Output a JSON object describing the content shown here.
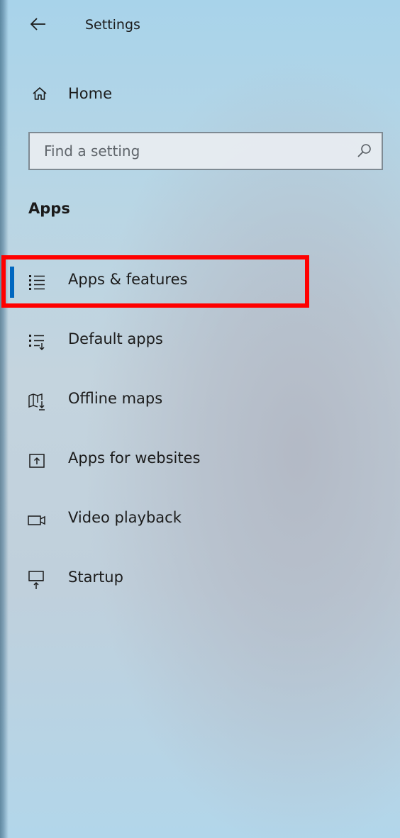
{
  "header": {
    "title": "Settings",
    "back_icon": "back-arrow-icon"
  },
  "home": {
    "label": "Home",
    "icon": "home-icon"
  },
  "search": {
    "placeholder": "Find a setting",
    "value": "",
    "icon": "search-icon"
  },
  "section": {
    "heading": "Apps"
  },
  "nav": {
    "items": [
      {
        "label": "Apps & features",
        "icon": "apps-features-icon",
        "selected": true
      },
      {
        "label": "Default apps",
        "icon": "default-apps-icon",
        "selected": false
      },
      {
        "label": "Offline maps",
        "icon": "offline-maps-icon",
        "selected": false
      },
      {
        "label": "Apps for websites",
        "icon": "apps-for-websites-icon",
        "selected": false
      },
      {
        "label": "Video playback",
        "icon": "video-playback-icon",
        "selected": false
      },
      {
        "label": "Startup",
        "icon": "startup-icon",
        "selected": false
      }
    ]
  },
  "colors": {
    "accent": "#0067c0",
    "highlight": "#ff0000",
    "text": "#1b1b1b"
  }
}
